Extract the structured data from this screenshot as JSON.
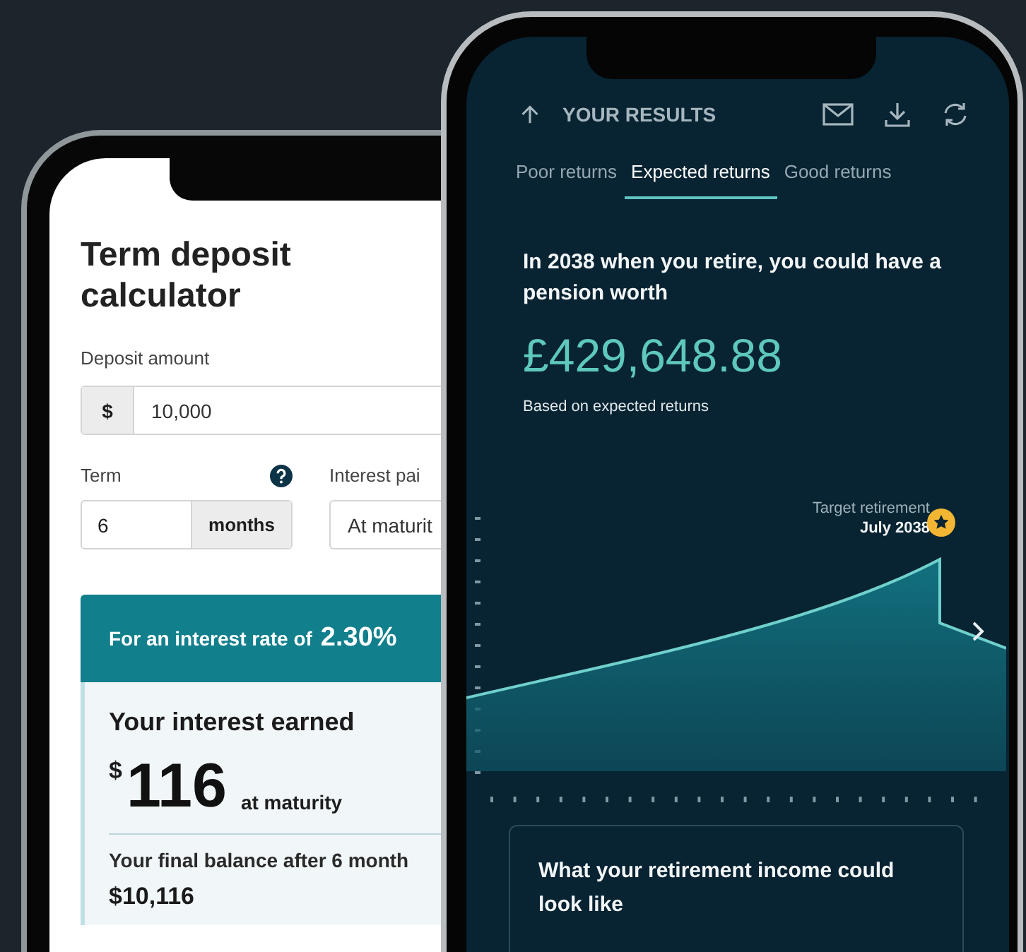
{
  "left_phone": {
    "title": "Term deposit calculator",
    "deposit": {
      "label": "Deposit amount",
      "prefix": "$",
      "value": "10,000"
    },
    "term": {
      "label": "Term",
      "value": "6",
      "unit": "months"
    },
    "interest_paid": {
      "label": "Interest pai",
      "value": "At maturit"
    },
    "result": {
      "rate_label": "For an interest rate of",
      "rate": "2.30%",
      "heading": "Your interest earned",
      "currency": "$",
      "amount": "116",
      "amount_note": "at maturity",
      "balance_label": "Your final balance after 6 month",
      "balance": "$10,116"
    }
  },
  "right_phone": {
    "header": {
      "title": "YOUR RESULTS"
    },
    "tabs": [
      {
        "label": "Poor returns",
        "selected": false
      },
      {
        "label": "Expected returns",
        "selected": true
      },
      {
        "label": "Good returns",
        "selected": false
      }
    ],
    "summary": "In 2038 when you retire, you could have a pension worth",
    "amount": "£429,648.88",
    "note": "Based on expected returns",
    "chart": {
      "marker_label": "Target retirement",
      "marker_date": "July 2038"
    },
    "card": {
      "title": "What your retirement income could look like"
    }
  }
}
